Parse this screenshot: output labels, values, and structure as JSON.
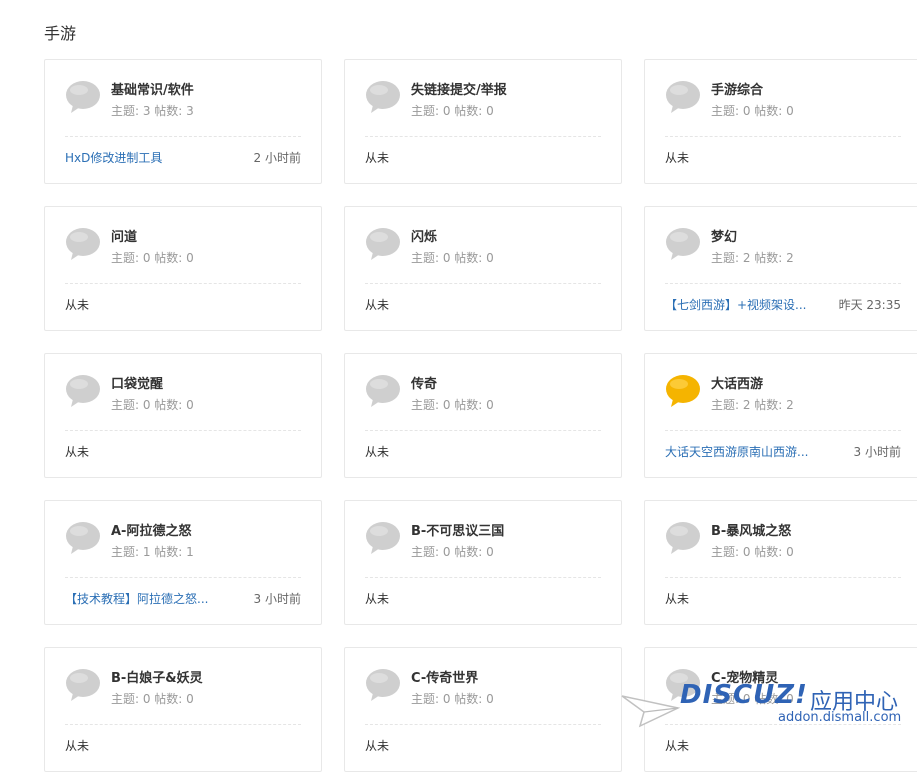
{
  "section_title": "手游",
  "forums": [
    {
      "name": "基础常识/软件",
      "topics_label": "主题:",
      "topics": "3",
      "posts_label": "帖数:",
      "posts": "3",
      "last": "HxD修改进制工具",
      "time": "2 小时前",
      "icon": "chat-bubble-gray"
    },
    {
      "name": "失链接提交/举报",
      "topics_label": "主题:",
      "topics": "0",
      "posts_label": "帖数:",
      "posts": "0",
      "last": "从未",
      "time": "",
      "icon": "chat-bubble-gray"
    },
    {
      "name": "手游综合",
      "topics_label": "主题:",
      "topics": "0",
      "posts_label": "帖数:",
      "posts": "0",
      "last": "从未",
      "time": "",
      "icon": "chat-bubble-gray"
    },
    {
      "name": "问道",
      "topics_label": "主题:",
      "topics": "0",
      "posts_label": "帖数:",
      "posts": "0",
      "last": "从未",
      "time": "",
      "icon": "chat-bubble-gray"
    },
    {
      "name": "闪烁",
      "topics_label": "主题:",
      "topics": "0",
      "posts_label": "帖数:",
      "posts": "0",
      "last": "从未",
      "time": "",
      "icon": "chat-bubble-gray"
    },
    {
      "name": "梦幻",
      "topics_label": "主题:",
      "topics": "2",
      "posts_label": "帖数:",
      "posts": "2",
      "last": "【七剑西游】+视频架设...",
      "time": "昨天 23:35",
      "icon": "chat-bubble-gray"
    },
    {
      "name": "口袋觉醒",
      "topics_label": "主题:",
      "topics": "0",
      "posts_label": "帖数:",
      "posts": "0",
      "last": "从未",
      "time": "",
      "icon": "chat-bubble-gray"
    },
    {
      "name": "传奇",
      "topics_label": "主题:",
      "topics": "0",
      "posts_label": "帖数:",
      "posts": "0",
      "last": "从未",
      "time": "",
      "icon": "chat-bubble-gray"
    },
    {
      "name": "大话西游",
      "topics_label": "主题:",
      "topics": "2",
      "posts_label": "帖数:",
      "posts": "2",
      "last": "大话天空西游原南山西游...",
      "time": "3 小时前",
      "icon": "chat-bubble-yellow"
    },
    {
      "name": "A-阿拉德之怒",
      "topics_label": "主题:",
      "topics": "1",
      "posts_label": "帖数:",
      "posts": "1",
      "last": "【技术教程】阿拉德之怒...",
      "time": "3 小时前",
      "icon": "chat-bubble-gray"
    },
    {
      "name": "B-不可思议三国",
      "topics_label": "主题:",
      "topics": "0",
      "posts_label": "帖数:",
      "posts": "0",
      "last": "从未",
      "time": "",
      "icon": "chat-bubble-gray"
    },
    {
      "name": "B-暴风城之怒",
      "topics_label": "主题:",
      "topics": "0",
      "posts_label": "帖数:",
      "posts": "0",
      "last": "从未",
      "time": "",
      "icon": "chat-bubble-gray"
    },
    {
      "name": "B-白娘子&妖灵",
      "topics_label": "主题:",
      "topics": "0",
      "posts_label": "帖数:",
      "posts": "0",
      "last": "从未",
      "time": "",
      "icon": "chat-bubble-gray"
    },
    {
      "name": "C-传奇世界",
      "topics_label": "主题:",
      "topics": "0",
      "posts_label": "帖数:",
      "posts": "0",
      "last": "从未",
      "time": "",
      "icon": "chat-bubble-gray"
    },
    {
      "name": "C-宠物精灵",
      "topics_label": "主题:",
      "topics": "0",
      "posts_label": "帖数:",
      "posts": "0",
      "last": "从未",
      "time": "",
      "icon": "chat-bubble-gray"
    }
  ],
  "watermark": {
    "brand": "DISCUZ!",
    "cn": "应用中心",
    "url": "addon.dismall.com"
  },
  "colors": {
    "link": "#2b6fb5",
    "gray_icon": "#cccccc",
    "yellow_icon": "#f5b400"
  }
}
